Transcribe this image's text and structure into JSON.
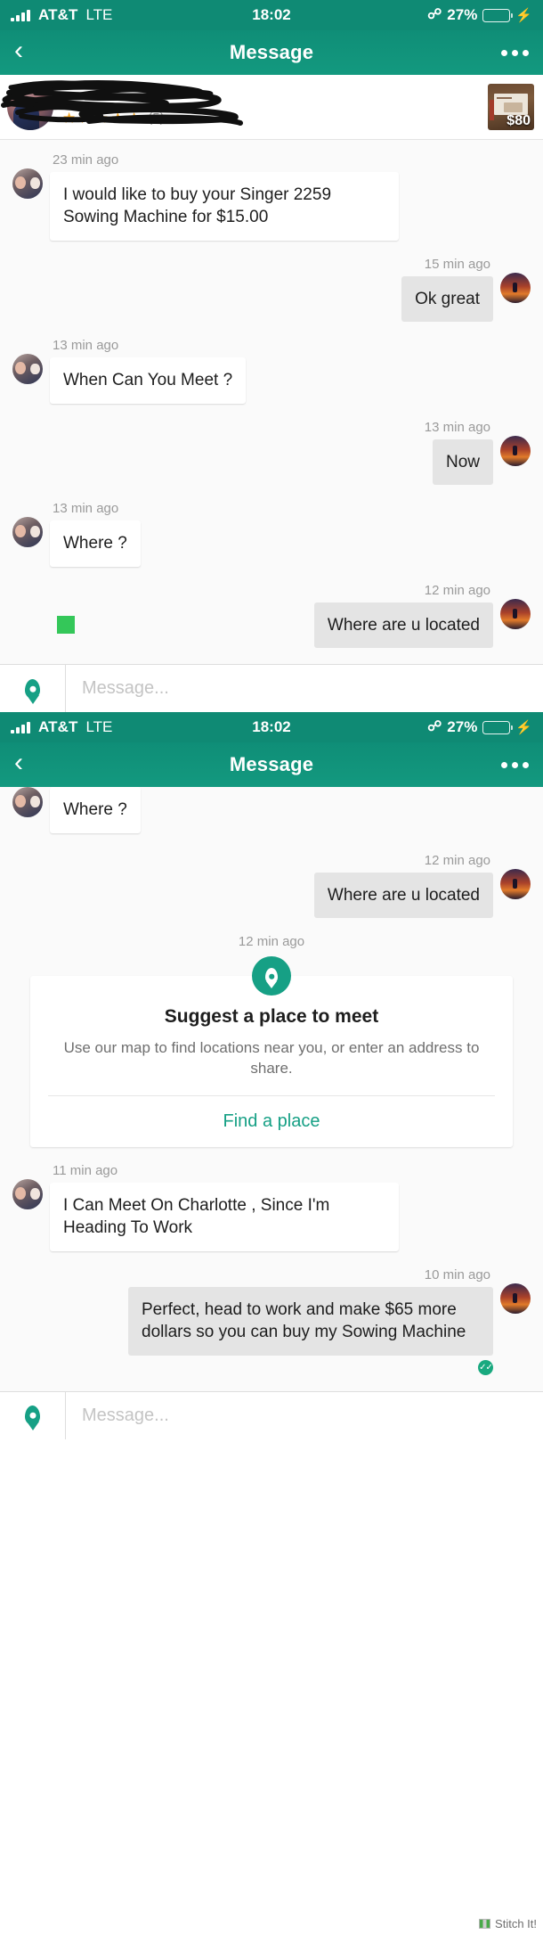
{
  "status_bar": {
    "carrier": "AT&T",
    "network": "LTE",
    "time": "18:02",
    "bluetooth_icon": "bluetooth-icon",
    "battery_percent": "27%",
    "charging_icon": "lightning-bolt-icon",
    "signal_icon": "signal-bars-icon"
  },
  "nav": {
    "back_icon": "chevron-left-icon",
    "title": "Message",
    "more_icon": "overflow-menu-icon"
  },
  "product_header": {
    "seller_name": "",
    "seller_name_redacted": true,
    "stars": 5,
    "rating_count": "(5)",
    "star_color": "#f5a623",
    "product_price": "$80",
    "product_thumb_alt": "sewing-machine-box"
  },
  "theme": {
    "header_green": "#13957d",
    "status_green": "#0f8a74",
    "accent_green": "#16a085",
    "in_bubble": "#ffffff",
    "out_bubble": "#e4e4e4",
    "page_bg": "#fafafa",
    "marker_green": "#34c759"
  },
  "screen1": {
    "messages": [
      {
        "side": "in",
        "time": "23 min ago",
        "text": "I would like to buy your Singer 2259 Sowing Machine for $15.00"
      },
      {
        "side": "out",
        "time": "15 min ago",
        "text": "Ok great"
      },
      {
        "side": "in",
        "time": "13 min ago",
        "text": "When Can You Meet ?"
      },
      {
        "side": "out",
        "time": "13 min ago",
        "text": "Now"
      },
      {
        "side": "in",
        "time": "13 min ago",
        "text": "Where ?"
      },
      {
        "side": "out",
        "time": "12 min ago",
        "text": "Where are u located"
      }
    ],
    "annotation_marker": "green-square-highlight",
    "input": {
      "placeholder": "Message...",
      "value": "",
      "location_icon": "location-pin-icon"
    }
  },
  "screen2": {
    "messages_top": [
      {
        "side": "in",
        "time": "",
        "text": "Where ?"
      },
      {
        "side": "out",
        "time": "12 min ago",
        "text": "Where are u located"
      }
    ],
    "place_card": {
      "time": "12 min ago",
      "pin_icon": "location-pin-icon",
      "title": "Suggest a place to meet",
      "subtitle": "Use our map to find locations near you, or enter an address to share.",
      "action_label": "Find a place"
    },
    "messages_bottom": [
      {
        "side": "in",
        "time": "11 min ago",
        "text": "I Can Meet On Charlotte , Since I'm Heading To Work"
      },
      {
        "side": "out",
        "time": "10 min ago",
        "text": "Perfect, head to work and make $65 more dollars so you can buy my Sowing Machine",
        "read_receipt": "✓✓"
      }
    ],
    "input": {
      "placeholder": "Message...",
      "value": "",
      "location_icon": "location-pin-icon"
    }
  },
  "watermark": {
    "label": "Stitch It!",
    "logo_icon": "stitch-it-logo-icon"
  }
}
